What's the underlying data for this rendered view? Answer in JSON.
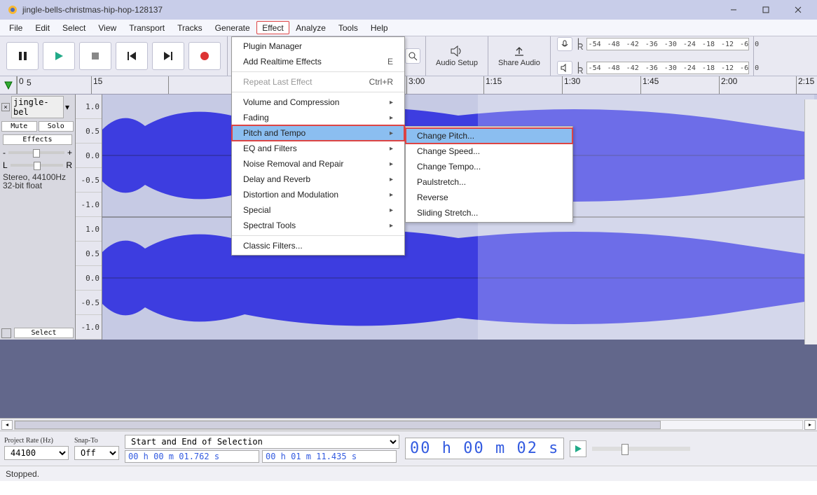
{
  "window": {
    "title": "jingle-bells-christmas-hip-hop-128137"
  },
  "menubar": {
    "items": [
      "File",
      "Edit",
      "Select",
      "View",
      "Transport",
      "Tracks",
      "Generate",
      "Effect",
      "Analyze",
      "Tools",
      "Help"
    ],
    "open_index": 7
  },
  "toolbar": {
    "audio_setup": "Audio Setup",
    "share_audio": "Share Audio",
    "meter_labels": [
      "-54",
      "-48",
      "-42",
      "-36",
      "-30",
      "-24",
      "-18",
      "-12",
      "-6",
      "0"
    ]
  },
  "effect_menu": {
    "plugin_manager": "Plugin Manager",
    "add_realtime": "Add Realtime Effects",
    "add_realtime_sc": "E",
    "repeat": "Repeat Last Effect",
    "repeat_sc": "Ctrl+R",
    "groups": [
      "Volume and Compression",
      "Fading",
      "Pitch and Tempo",
      "EQ and Filters",
      "Noise Removal and Repair",
      "Delay and Reverb",
      "Distortion and Modulation",
      "Special",
      "Spectral Tools"
    ],
    "classic": "Classic Filters...",
    "highlighted_index": 2
  },
  "pitch_submenu": {
    "items": [
      "Change Pitch...",
      "Change Speed...",
      "Change Tempo...",
      "Paulstretch...",
      "Reverse",
      "Sliding Stretch..."
    ],
    "highlighted_index": 0
  },
  "timeline": {
    "ticks": [
      "5",
      "0",
      "15",
      "",
      "",
      "",
      "3:00",
      "1:15",
      "1:30",
      "1:45",
      "2:00",
      "2:15"
    ],
    "visible": [
      "5",
      "0",
      "15",
      "3:00",
      "1:15",
      "1:30",
      "1:45",
      "2:00",
      "2:15"
    ]
  },
  "track": {
    "name_short": "jingle-bel",
    "name_long": "jingle-bells-christmas-hip-h",
    "mute": "Mute",
    "solo": "Solo",
    "effects": "Effects",
    "gain_minus": "-",
    "gain_plus": "+",
    "pan_l": "L",
    "pan_r": "R",
    "info1": "Stereo, 44100Hz",
    "info2": "32-bit float",
    "select": "Select",
    "vscale": [
      "1.0",
      "0.5",
      "0.0",
      "-0.5",
      "-1.0",
      "1.0",
      "0.5",
      "0.0",
      "-0.5",
      "-1.0"
    ]
  },
  "selection_bar": {
    "project_rate_label": "Project Rate (Hz)",
    "project_rate": "44100",
    "snap_label": "Snap-To",
    "snap": "Off",
    "sel_mode": "Start and End of Selection",
    "start": "00 h 00 m 01.762 s",
    "end": "00 h 01 m 11.435 s",
    "big_time": "00 h 00 m 02 s"
  },
  "status": {
    "text": "Stopped."
  }
}
